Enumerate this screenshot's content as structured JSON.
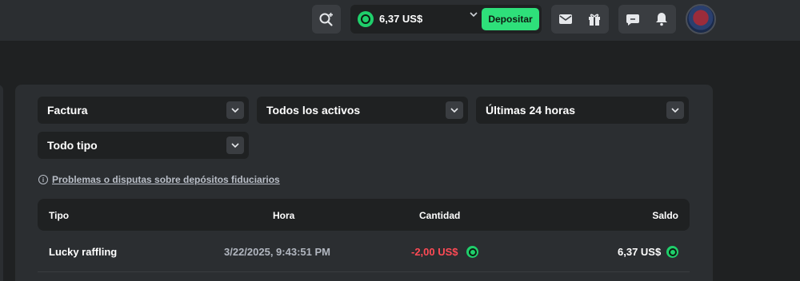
{
  "header": {
    "wallet": {
      "amount": "6,37 US$",
      "currency_icon": "coin-icon"
    },
    "deposit_label": "Depositar",
    "icons": [
      "search-plus-icon",
      "chevron-down-icon",
      "mail-icon",
      "gift-icon",
      "chat-icon",
      "bell-icon",
      "avatar"
    ]
  },
  "filters": {
    "type": "Factura",
    "assets": "Todos los activos",
    "period": "Últimas 24 horas",
    "kind": "Todo tipo"
  },
  "notice": {
    "link_text": "Problemas o disputas sobre depósitos fiduciarios"
  },
  "table": {
    "headers": {
      "tipo": "Tipo",
      "hora": "Hora",
      "cantidad": "Cantidad",
      "saldo": "Saldo"
    },
    "rows": [
      {
        "tipo": "Lucky raffling",
        "hora": "3/22/2025, 9:43:51 PM",
        "cantidad": "-2,00 US$",
        "saldo": "6,37 US$"
      }
    ]
  },
  "colors": {
    "accent": "#2ee07a",
    "negative": "#ff4a55",
    "background": "#1f2122",
    "panel": "#2b2e31"
  }
}
